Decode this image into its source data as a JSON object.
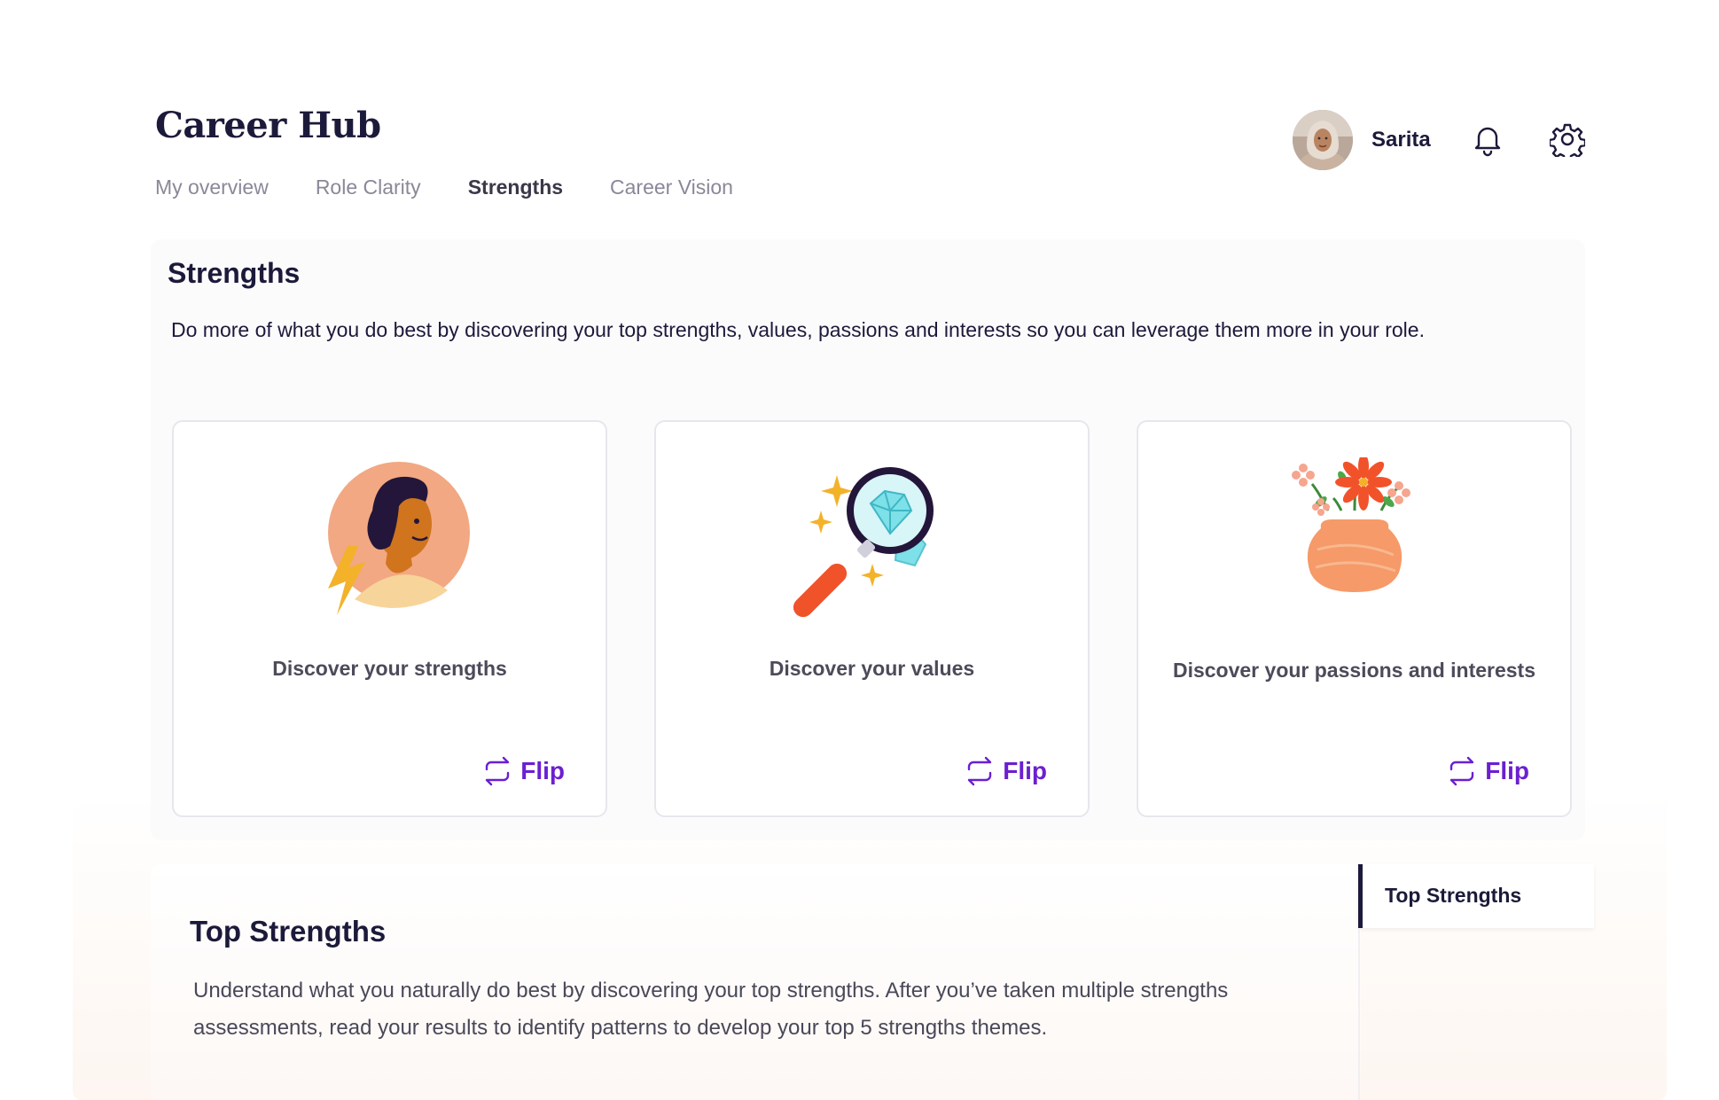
{
  "header": {
    "title": "Career Hub",
    "tabs": [
      {
        "label": "My overview",
        "active": false
      },
      {
        "label": "Role Clarity",
        "active": false
      },
      {
        "label": "Strengths",
        "active": true
      },
      {
        "label": "Career Vision",
        "active": false
      }
    ],
    "user": {
      "name": "Sarita"
    },
    "icons": [
      "bell-icon",
      "gear-icon"
    ]
  },
  "strengths": {
    "title": "Strengths",
    "description": "Do more of what you do best by discovering your top strengths, values, passions and interests so you can leverage them more in your role.",
    "cards": [
      {
        "label": "Discover your strengths",
        "flip": "Flip",
        "illustration": "person-with-lightning"
      },
      {
        "label": "Discover your values",
        "flip": "Flip",
        "illustration": "magnifier-with-diamond"
      },
      {
        "label": "Discover your passions and interests",
        "flip": "Flip",
        "illustration": "flower-vase"
      }
    ]
  },
  "top_strengths": {
    "title": "Top Strengths",
    "description": "Understand what you naturally do best by discovering your top strengths. After you’ve taken multiple strengths assessments, read your results to identify patterns to develop your top 5 strengths themes."
  },
  "side_nav": {
    "items": [
      {
        "label": "Top Strengths",
        "active": true
      }
    ]
  },
  "colors": {
    "accent": "#6b1fd1",
    "heading": "#1c1a3a",
    "muted": "#8a8898"
  }
}
